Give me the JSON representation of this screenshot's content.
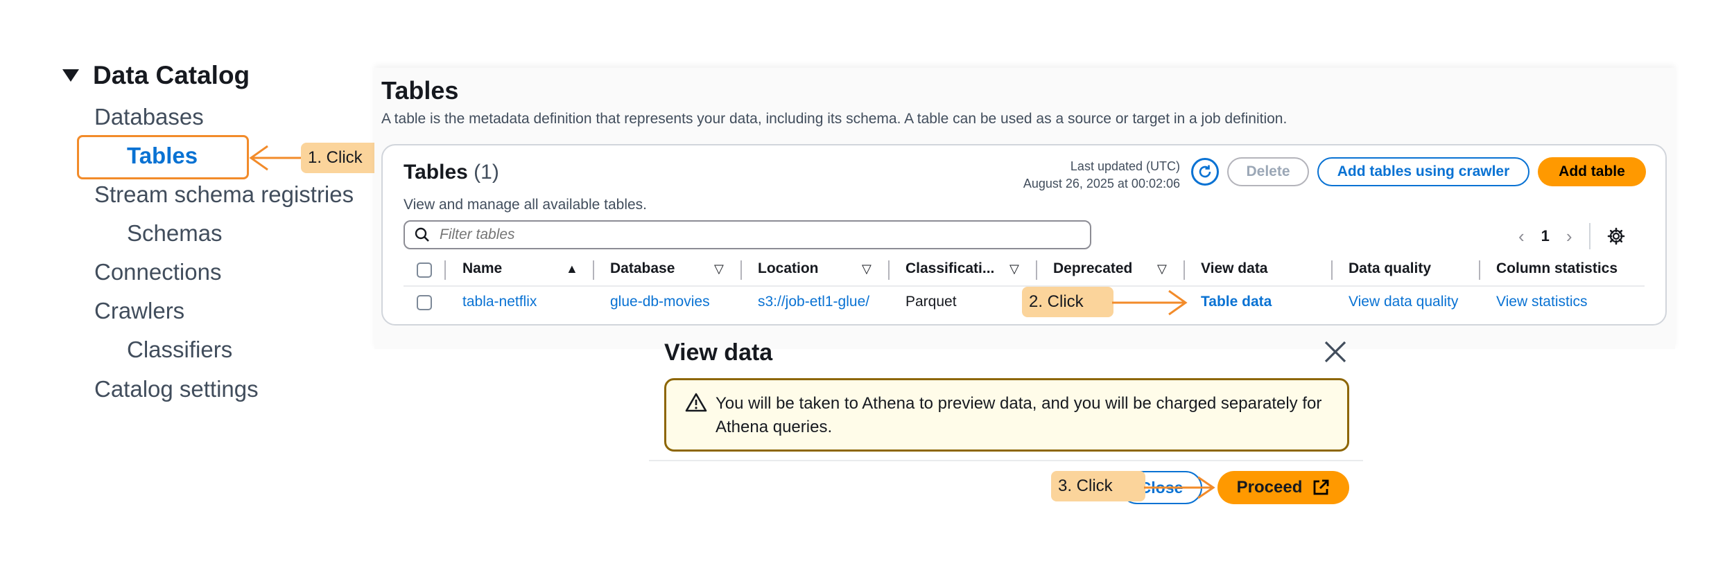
{
  "nav": {
    "section_title": "Data Catalog",
    "items": [
      {
        "label": "Databases"
      },
      {
        "label": "Tables"
      },
      {
        "label": "Stream schema registries"
      },
      {
        "label": "Schemas"
      },
      {
        "label": "Connections"
      },
      {
        "label": "Crawlers"
      },
      {
        "label": "Classifiers"
      },
      {
        "label": "Catalog settings"
      }
    ]
  },
  "page": {
    "title": "Tables",
    "description": "A table is the metadata definition that represents your data, including its schema. A table can be used as a source or target in a job definition."
  },
  "card": {
    "title": "Tables",
    "count": "(1)",
    "description": "View and manage all available tables.",
    "updated_label": "Last updated (UTC)",
    "updated_value": "August 26, 2025 at 00:02:06",
    "delete_label": "Delete",
    "crawler_label": "Add tables using crawler",
    "add_label": "Add table",
    "search_placeholder": "Filter tables",
    "page_number": "1"
  },
  "table": {
    "headers": [
      "Name",
      "Database",
      "Location",
      "Classificati...",
      "Deprecated",
      "View data",
      "Data quality",
      "Column statistics"
    ],
    "rows": [
      {
        "name": "tabla-netflix",
        "database": "glue-db-movies",
        "location": "s3://job-etl1-glue/",
        "classification": "Parquet",
        "deprecated": "",
        "view_data": "Table data",
        "data_quality": "View data quality",
        "column_statistics": "View statistics"
      }
    ]
  },
  "modal": {
    "title": "View data",
    "alert": "You will be taken to Athena to preview data, and you will be charged separately for Athena queries.",
    "close_label": "Close",
    "proceed_label": "Proceed"
  },
  "annotations": {
    "step1": "1. Click",
    "step2": "2. Click",
    "step3": "3. Click",
    "accent": "#f28b2a",
    "callout_color": "#fbd49b"
  },
  "colors": {
    "link": "#0972d3",
    "primary_button": "#ff9900",
    "alert_border": "#8d6605",
    "alert_bg": "#fffce9"
  }
}
